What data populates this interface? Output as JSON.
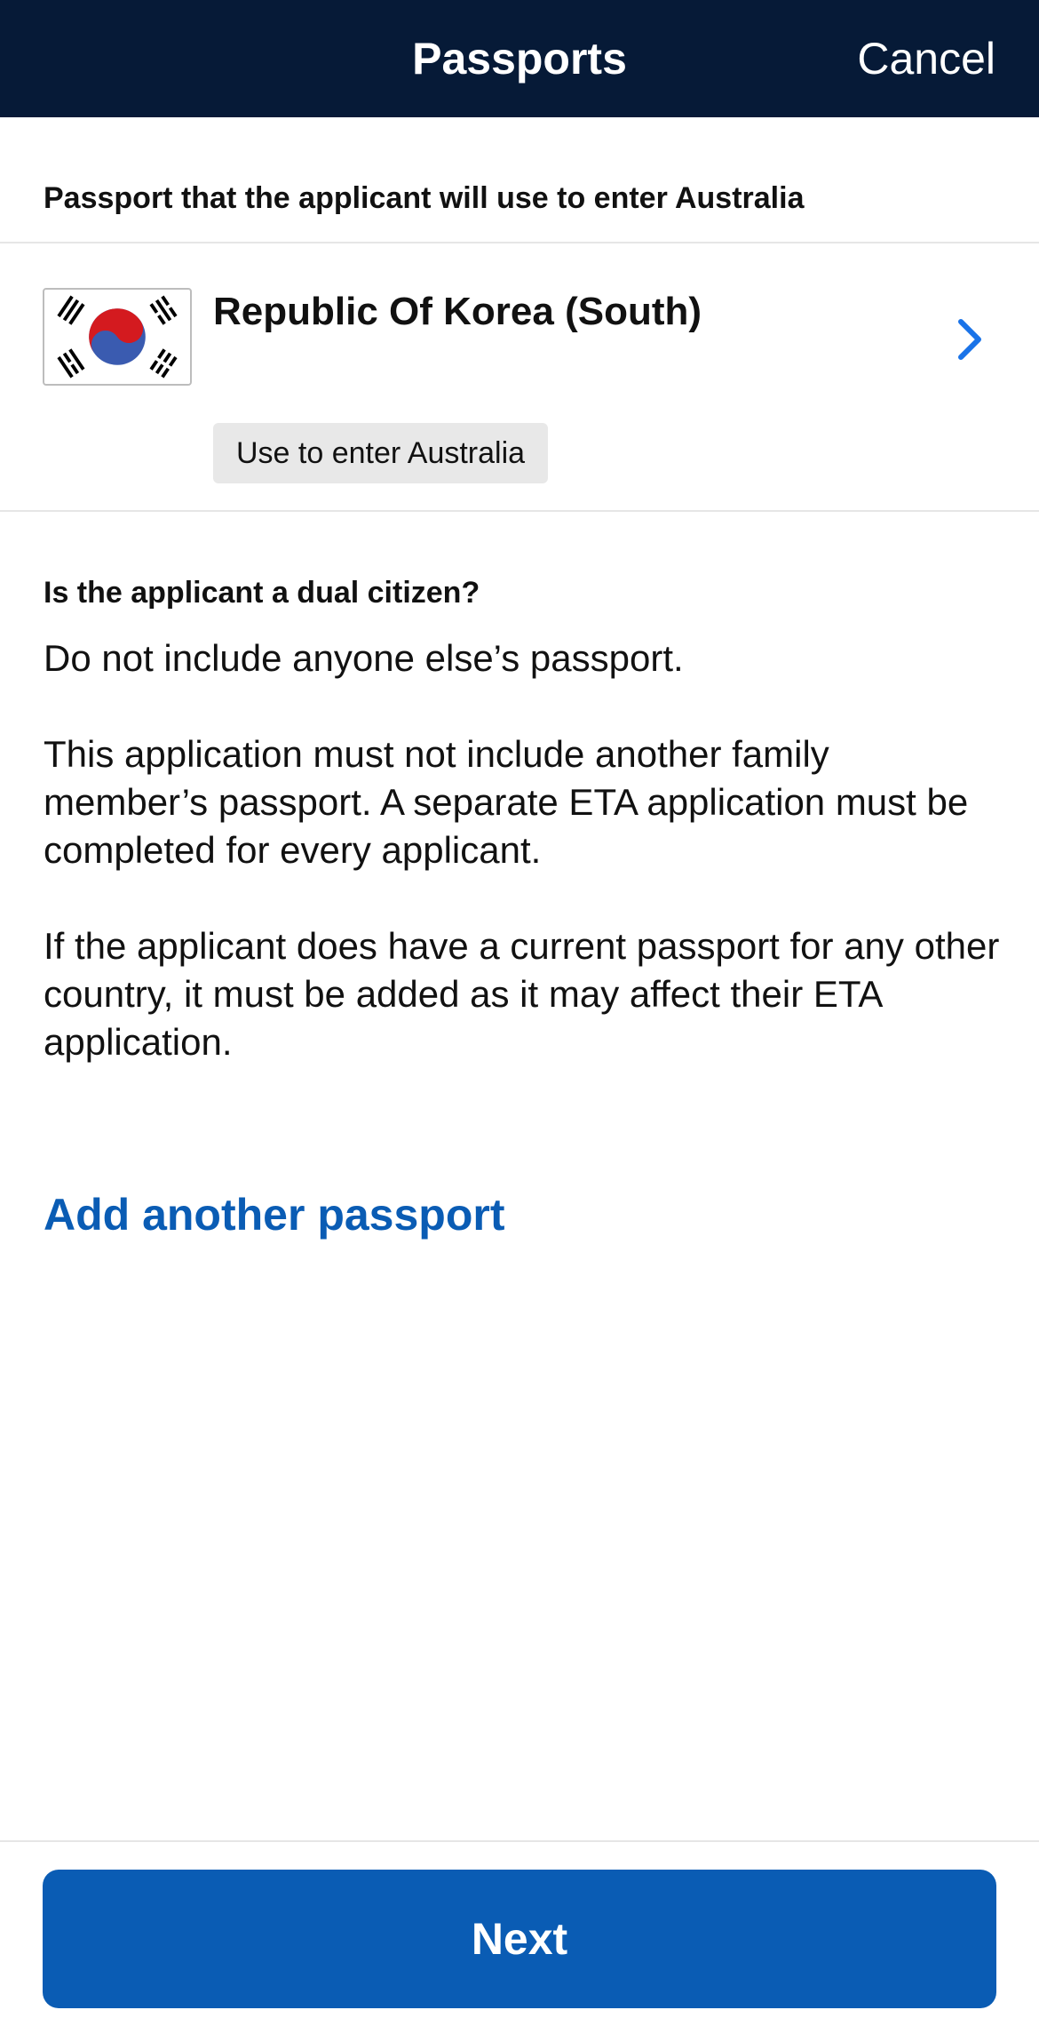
{
  "header": {
    "title": "Passports",
    "cancel_label": "Cancel",
    "background_color": "#061a37"
  },
  "passport_section": {
    "label": "Passport that the applicant will use to enter Australia",
    "passport": {
      "country": "Republic Of Korea (South)",
      "flag_icon": "south-korea-flag-icon",
      "badge": "Use to enter Australia"
    }
  },
  "dual_citizen": {
    "heading": "Is the applicant a dual citizen?",
    "paragraphs": [
      "Do not include anyone else’s passport.",
      "This application must not include another family member’s passport. A separate ETA application must be completed for every applicant.",
      "If the applicant does have a current passport for any other country, it must be added as it may affect their ETA application."
    ]
  },
  "actions": {
    "add_passport_label": "Add another passport",
    "next_label": "Next",
    "accent_color": "#0a5cb4"
  }
}
